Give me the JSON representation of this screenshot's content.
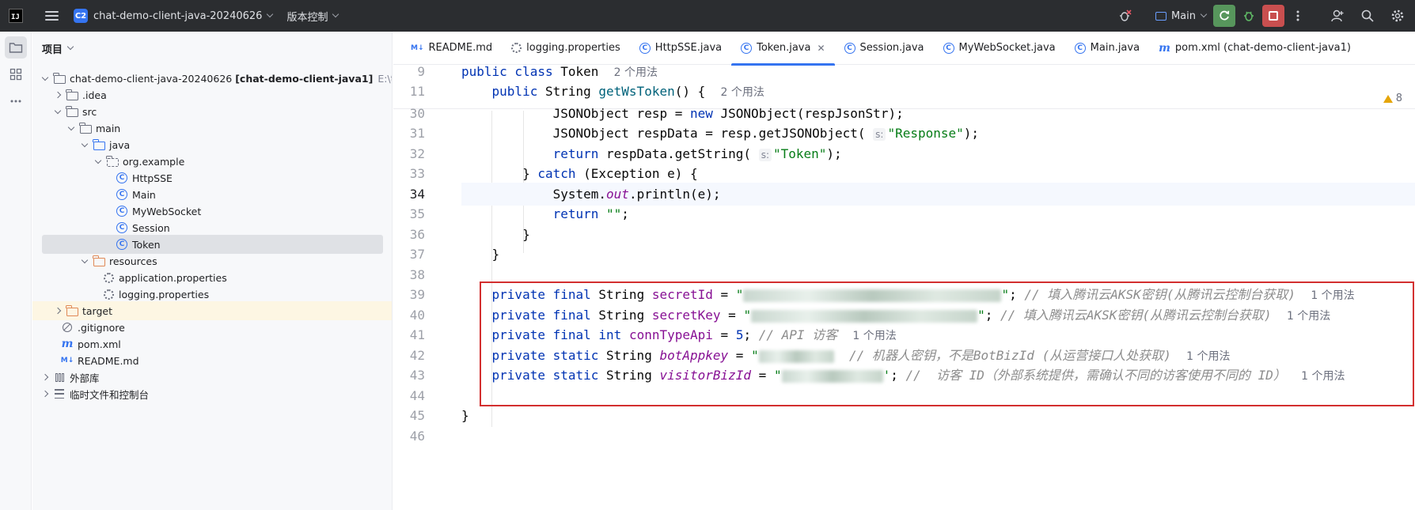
{
  "topbar": {
    "project_badge": "C2",
    "project_name": "chat-demo-client-java-20240626",
    "vcs_label": "版本控制",
    "run_config": "Main"
  },
  "project_panel": {
    "title": "项目",
    "tree": [
      {
        "label": "chat-demo-client-java-20240626",
        "bold": "[chat-demo-client-java1]",
        "path": "E:\\tools\\c",
        "icon": "folder-icon",
        "arrow": "down"
      },
      {
        "label": ".idea",
        "icon": "folder-icon",
        "arrow": "right"
      },
      {
        "label": "src",
        "icon": "folder-icon",
        "arrow": "down"
      },
      {
        "label": "main",
        "icon": "folder-icon",
        "arrow": "down"
      },
      {
        "label": "java",
        "icon": "source-folder-icon",
        "arrow": "down"
      },
      {
        "label": "org.example",
        "icon": "package-icon",
        "arrow": "down"
      },
      {
        "label": "HttpSSE",
        "icon": "class-icon"
      },
      {
        "label": "Main",
        "icon": "class-icon"
      },
      {
        "label": "MyWebSocket",
        "icon": "class-icon"
      },
      {
        "label": "Session",
        "icon": "class-icon"
      },
      {
        "label": "Token",
        "icon": "class-icon",
        "selected": true
      },
      {
        "label": "resources",
        "icon": "resources-folder-icon",
        "arrow": "down"
      },
      {
        "label": "application.properties",
        "icon": "properties-icon"
      },
      {
        "label": "logging.properties",
        "icon": "properties-icon"
      },
      {
        "label": "target",
        "icon": "excluded-folder-icon",
        "arrow": "right",
        "excluded": true
      },
      {
        "label": ".gitignore",
        "icon": "ignore-icon"
      },
      {
        "label": "pom.xml",
        "icon": "maven-icon"
      },
      {
        "label": "README.md",
        "icon": "markdown-icon"
      },
      {
        "label": "外部库",
        "icon": "library-icon",
        "arrow": "right"
      },
      {
        "label": "临时文件和控制台",
        "icon": "scratch-icon",
        "arrow": "right"
      }
    ]
  },
  "tabs": [
    {
      "label": "README.md",
      "icon": "markdown-icon"
    },
    {
      "label": "logging.properties",
      "icon": "properties-icon"
    },
    {
      "label": "HttpSSE.java",
      "icon": "class-icon"
    },
    {
      "label": "Token.java",
      "icon": "class-icon",
      "active": true
    },
    {
      "label": "Session.java",
      "icon": "class-icon"
    },
    {
      "label": "MyWebSocket.java",
      "icon": "class-icon"
    },
    {
      "label": "Main.java",
      "icon": "class-icon"
    },
    {
      "label": "pom.xml (chat-demo-client-java1)",
      "icon": "maven-icon"
    }
  ],
  "editor": {
    "warnings_count": "8",
    "sticky": {
      "l9": {
        "num": "9",
        "usage": "2 个用法"
      },
      "l11": {
        "num": "11",
        "usage": "2 个用法"
      }
    },
    "lines": {
      "l30": "30",
      "l31": "31",
      "l32": "32",
      "l33": "33",
      "l34": "34",
      "l35": "35",
      "l36": "36",
      "l37": "37",
      "l38": "38",
      "l39": "39",
      "l40": "40",
      "l41": "41",
      "l42": "42",
      "l43": "43",
      "l44": "44",
      "l45": "45",
      "l46": "46"
    },
    "code": {
      "resp_str": "\"Response\"",
      "token_str": "\"Token\"",
      "empty_str": "\"\"",
      "hint_s": "s:",
      "c39": "// 填入腾讯云AKSK密钥(从腾讯云控制台获取)",
      "c40": "// 填入腾讯云AKSK密钥(从腾讯云控制台获取)",
      "c41": "// API 访客",
      "c42": "// 机器人密钥，不是BotBizId (从运营接口人处获取)",
      "c43": "//  访客 ID（外部系统提供，需确认不同的访客使用不同的 ID）",
      "usage1": "1 个用法",
      "conn_val": "5"
    }
  }
}
